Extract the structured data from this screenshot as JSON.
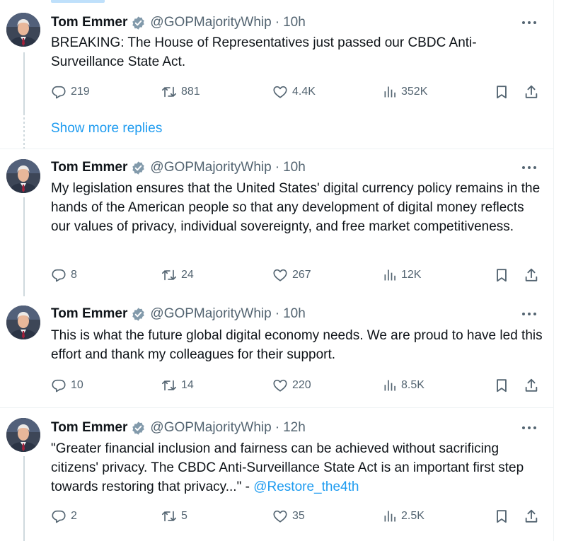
{
  "author": {
    "name": "Tom Emmer",
    "handle": "@GOPMajorityWhip",
    "verified_badge_icon": "verified-badge-icon",
    "badge_color": "#829aab"
  },
  "show_more_replies": "Show more replies",
  "colors": {
    "accent": "#1d9bf0",
    "secondary_text": "#536471",
    "thread_line": "#cfd9de"
  },
  "tweets": [
    {
      "time": "10h",
      "text": "BREAKING: The House of Representatives just passed our CBDC Anti-Surveillance State Act.",
      "stats": {
        "replies": "219",
        "reposts": "881",
        "likes": "4.4K",
        "views": "352K"
      }
    },
    {
      "time": "10h",
      "text": "My legislation ensures that the United States' digital currency policy remains in the hands of the American people so that any development of digital money reflects our values of privacy, individual sovereignty, and free market competitiveness.",
      "stats": {
        "replies": "8",
        "reposts": "24",
        "likes": "267",
        "views": "12K"
      }
    },
    {
      "time": "10h",
      "text": "This is what the future global digital economy needs. We are proud to have led this effort and thank my colleagues for their support.",
      "stats": {
        "replies": "10",
        "reposts": "14",
        "likes": "220",
        "views": "8.5K"
      }
    },
    {
      "time": "12h",
      "text": "\"Greater financial inclusion and fairness can be achieved without sacrificing citizens' privacy. The CBDC Anti-Surveillance State Act is an important first step towards restoring that privacy...\" - ",
      "mention": "@Restore_the4th",
      "stats": {
        "replies": "2",
        "reposts": "5",
        "likes": "35",
        "views": "2.5K"
      }
    }
  ]
}
